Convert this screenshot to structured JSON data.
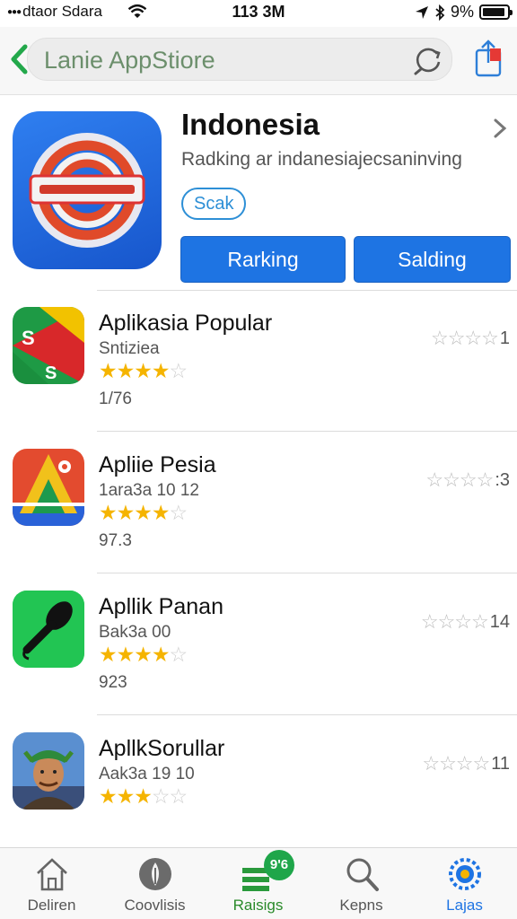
{
  "status_bar": {
    "carrier": "dtaor Sdara",
    "time": "113 3M",
    "battery": "9%"
  },
  "nav": {
    "url_label": "Lanie AppStiore"
  },
  "hero": {
    "title": "Indonesia",
    "subtitle": "Radking ar indanesiajecsaninving",
    "badge": "Scak",
    "button_ranking": "Rarking",
    "button_salding": "Salding"
  },
  "apps": [
    {
      "name": "Aplikasia Popular",
      "meta": "Sntiziea",
      "rating": 4,
      "count": "1/76",
      "right_value": "1"
    },
    {
      "name": "Apliie Pesia",
      "meta": "1ara3a 10 12",
      "rating": 4,
      "count": "97.3",
      "right_value": ":3"
    },
    {
      "name": "Apllik Panan",
      "meta": "Bak3a 00",
      "rating": 4,
      "count": "923",
      "right_value": "14"
    },
    {
      "name": "ApllkSorullar",
      "meta": "Aak3a 19 10",
      "rating": 3,
      "count": "",
      "right_value": "11"
    }
  ],
  "tabs": [
    {
      "label": "Deliren",
      "icon": "home-icon"
    },
    {
      "label": "Coovlisis",
      "icon": "compass-icon"
    },
    {
      "label": "Raisigs",
      "icon": "ranking-icon",
      "badge": "9'6"
    },
    {
      "label": "Kepns",
      "icon": "search-icon"
    },
    {
      "label": "Lajas",
      "icon": "updates-icon"
    }
  ],
  "colors": {
    "accent_blue": "#1e74e3",
    "star_yellow": "#f5b400",
    "active_green": "#2a8a2a"
  }
}
